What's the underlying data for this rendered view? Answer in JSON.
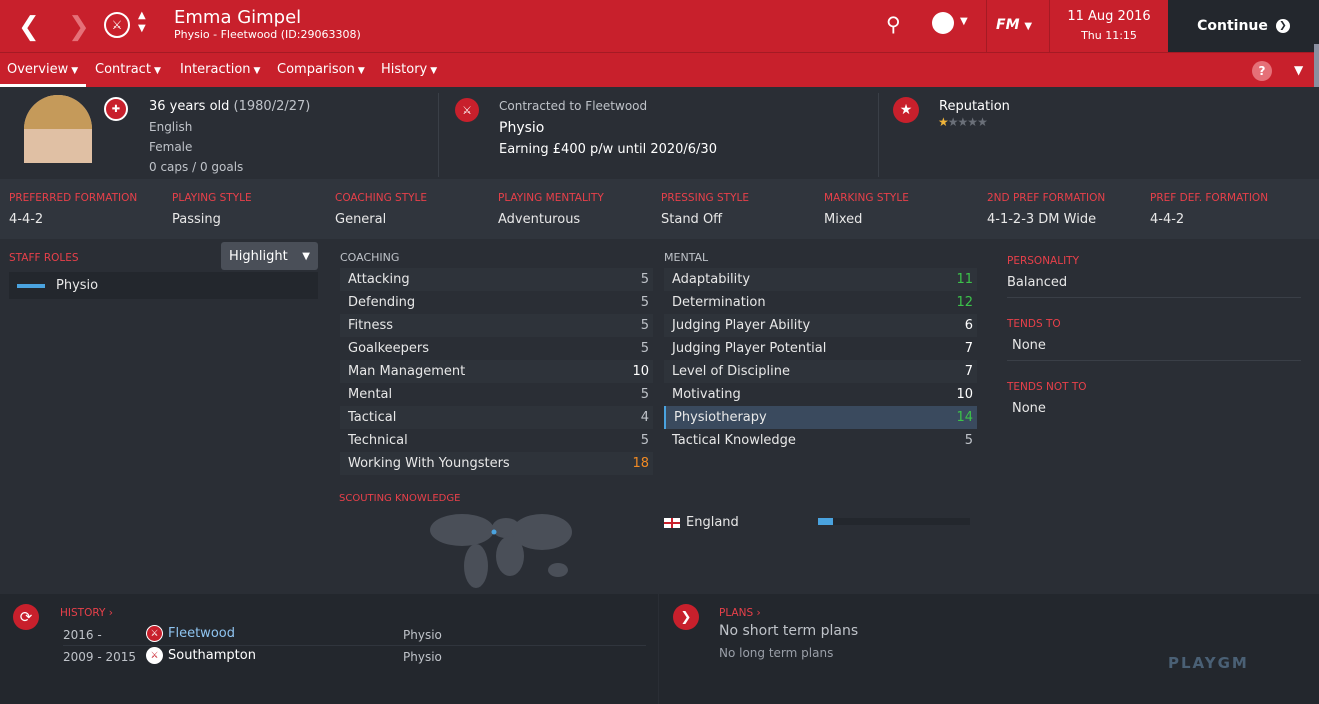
{
  "header": {
    "name": "Emma Gimpel",
    "subtitle": "Physio - Fleetwood (ID:29063308)",
    "date": "11 Aug 2016",
    "time": "Thu 11:15",
    "continue": "Continue",
    "fm": "FM"
  },
  "nav": [
    "Overview",
    "Contract",
    "Interaction",
    "Comparison",
    "History"
  ],
  "bio": {
    "age": "36 years old",
    "dob": "(1980/2/27)",
    "nationality": "English",
    "gender": "Female",
    "caps": "0 caps / 0 goals"
  },
  "contract": {
    "label": "Contracted to Fleetwood",
    "role": "Physio",
    "earning": "Earning £400 p/w until 2020/6/30"
  },
  "reputation": {
    "label": "Reputation",
    "stars": 1,
    "max": 5
  },
  "prefs": [
    {
      "label": "PREFERRED FORMATION",
      "value": "4-4-2"
    },
    {
      "label": "PLAYING STYLE",
      "value": "Passing"
    },
    {
      "label": "COACHING STYLE",
      "value": "General"
    },
    {
      "label": "PLAYING MENTALITY",
      "value": "Adventurous"
    },
    {
      "label": "PRESSING STYLE",
      "value": "Stand Off"
    },
    {
      "label": "MARKING STYLE",
      "value": "Mixed"
    },
    {
      "label": "2ND PREF FORMATION",
      "value": "4-1-2-3 DM Wide"
    },
    {
      "label": "PREF DEF. FORMATION",
      "value": "4-4-2"
    }
  ],
  "staff": {
    "label": "STAFF ROLES",
    "button": "Highlight",
    "role": "Physio"
  },
  "coaching": {
    "label": "COACHING",
    "rows": [
      {
        "name": "Attacking",
        "value": "5"
      },
      {
        "name": "Defending",
        "value": "5"
      },
      {
        "name": "Fitness",
        "value": "5"
      },
      {
        "name": "Goalkeepers",
        "value": "5"
      },
      {
        "name": "Man Management",
        "value": "10"
      },
      {
        "name": "Mental",
        "value": "5"
      },
      {
        "name": "Tactical",
        "value": "4"
      },
      {
        "name": "Technical",
        "value": "5"
      },
      {
        "name": "Working With Youngsters",
        "value": "18"
      }
    ]
  },
  "mental": {
    "label": "MENTAL",
    "rows": [
      {
        "name": "Adaptability",
        "value": "11"
      },
      {
        "name": "Determination",
        "value": "12"
      },
      {
        "name": "Judging Player Ability",
        "value": "6"
      },
      {
        "name": "Judging Player Potential",
        "value": "7"
      },
      {
        "name": "Level of Discipline",
        "value": "7"
      },
      {
        "name": "Motivating",
        "value": "10"
      },
      {
        "name": "Physiotherapy",
        "value": "14"
      },
      {
        "name": "Tactical Knowledge",
        "value": "5"
      }
    ]
  },
  "personality": {
    "label": "PERSONALITY",
    "value": "Balanced",
    "tends_label": "TENDS TO",
    "tends": "None",
    "tends_not_label": "TENDS NOT TO",
    "tends_not": "None"
  },
  "scouting": {
    "label": "SCOUTING KNOWLEDGE",
    "country": "England",
    "level": 0.1
  },
  "history": {
    "label": "HISTORY",
    "rows": [
      {
        "years": "2016 -",
        "club": "Fleetwood",
        "role": "Physio"
      },
      {
        "years": "2009 - 2015",
        "club": "Southampton",
        "role": "Physio"
      }
    ]
  },
  "plans": {
    "label": "PLANS",
    "short": "No short term plans",
    "long": "No long term plans"
  },
  "watermark": "PLAYGM"
}
